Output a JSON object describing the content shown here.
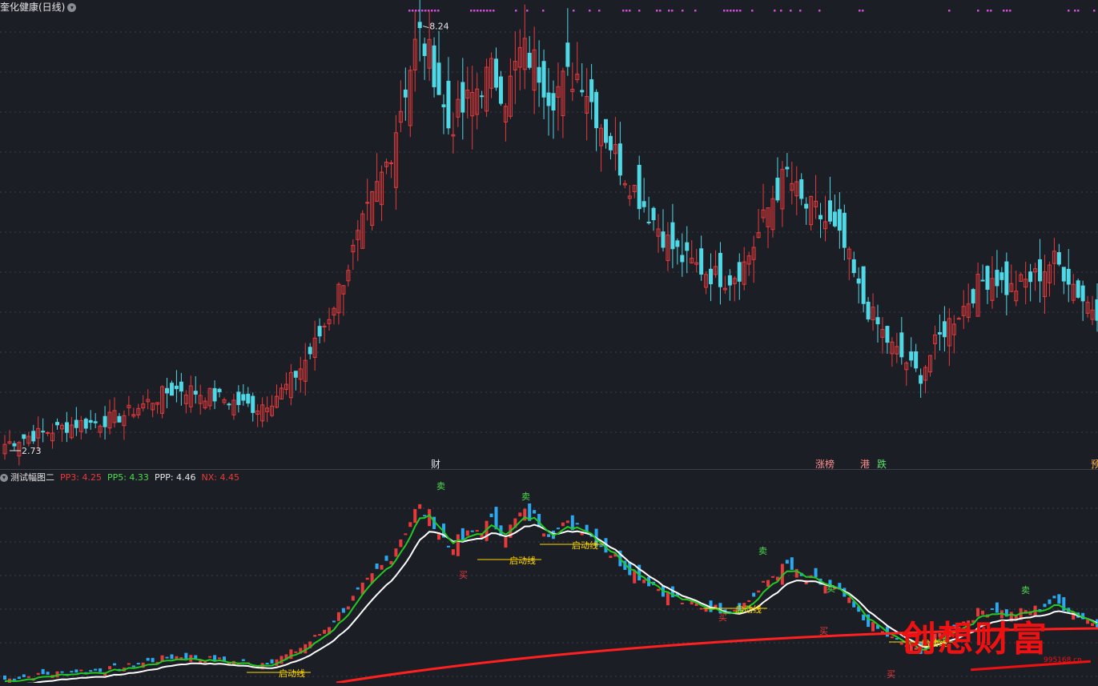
{
  "header": {
    "title": "奎化健康(日线)"
  },
  "price_chart": {
    "high_marker": "8.24",
    "low_marker": "2.73"
  },
  "events": [
    {
      "label": "财",
      "color": "#dfe3ea"
    },
    {
      "label": "涨榜",
      "color": "#ff8f8f"
    },
    {
      "label": "港",
      "color": "#ff8f8f"
    },
    {
      "label": "跌",
      "color": "#5de36a"
    },
    {
      "label": "预",
      "color": "#ffb347"
    }
  ],
  "indicator": {
    "name": "测试幅图二",
    "readouts": [
      {
        "label": "PP3: 4.25",
        "color": "#e83a3a"
      },
      {
        "label": "PP5: 4.33",
        "color": "#4ddb4d"
      },
      {
        "label": "PPP: 4.46",
        "color": "#e6e6e6"
      },
      {
        "label": "NX: 4.45",
        "color": "#e83a3a"
      }
    ],
    "signal_buy": "买",
    "signal_sell": "卖",
    "signal_start": "启动线"
  },
  "watermark": {
    "text": "创想财富",
    "url": "995168.cn"
  },
  "colors": {
    "up": "#e83a3a",
    "down": "#4fd8e6",
    "grid": "#3a3d47",
    "magenta": "#d04ed8",
    "ma_white": "#ffffff",
    "ma_green": "#22c922",
    "ma_red": "#ff2020",
    "start_line": "#ffd700"
  },
  "chart_data": [
    {
      "type": "candlestick",
      "title": "奎化健康(日线)",
      "y_reference": {
        "max": 8.24,
        "min": 2.73
      },
      "close_path": [
        2.73,
        2.8,
        2.85,
        2.9,
        2.95,
        3.0,
        3.0,
        3.05,
        3.1,
        3.2,
        3.3,
        3.4,
        3.45,
        3.4,
        3.35,
        3.3,
        3.25,
        3.2,
        3.3,
        3.45,
        3.7,
        4.0,
        4.4,
        4.9,
        5.4,
        5.9,
        6.4,
        7.2,
        8.0,
        7.6,
        6.8,
        7.0,
        7.3,
        7.5,
        7.2,
        7.8,
        7.6,
        7.2,
        7.4,
        7.5,
        7.0,
        6.6,
        6.2,
        5.9,
        5.6,
        5.3,
        5.1,
        5.0,
        4.9,
        4.85,
        5.0,
        5.4,
        5.9,
        6.2,
        5.8,
        5.7,
        5.5,
        5.2,
        4.6,
        4.3,
        4.0,
        3.8,
        3.6,
        4.0,
        4.3,
        4.5,
        4.8,
        4.9,
        4.7,
        4.8,
        4.9,
        5.1,
        4.9,
        4.6,
        4.45
      ]
    },
    {
      "type": "line",
      "title": "测试幅图二",
      "series": [
        {
          "name": "PP3",
          "last": 4.25
        },
        {
          "name": "PP5",
          "last": 4.33
        },
        {
          "name": "PPP",
          "last": 4.46
        },
        {
          "name": "NX",
          "last": 4.45
        }
      ]
    }
  ]
}
